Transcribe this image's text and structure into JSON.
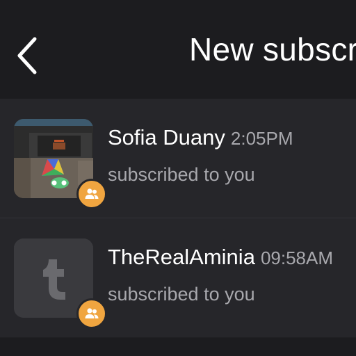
{
  "header": {
    "title": "New subscribers",
    "back_icon": "chevron-left-icon"
  },
  "notifications": [
    {
      "name": "Sofia Duany",
      "time": "2:05PM",
      "action": "subscribed to you",
      "avatar": "game-screenshot-thumbnail",
      "badge_icon": "people-icon"
    },
    {
      "name": "TheRealAminia",
      "time": "09:58AM",
      "action": "subscribed to you",
      "avatar": "default-t-avatar",
      "badge_icon": "people-icon"
    }
  ],
  "colors": {
    "background": "#1f1f22",
    "row_background": "#26262a",
    "badge": "#f0a540",
    "muted_text": "#a8a8ad",
    "default_avatar": "#3a3a3e"
  }
}
